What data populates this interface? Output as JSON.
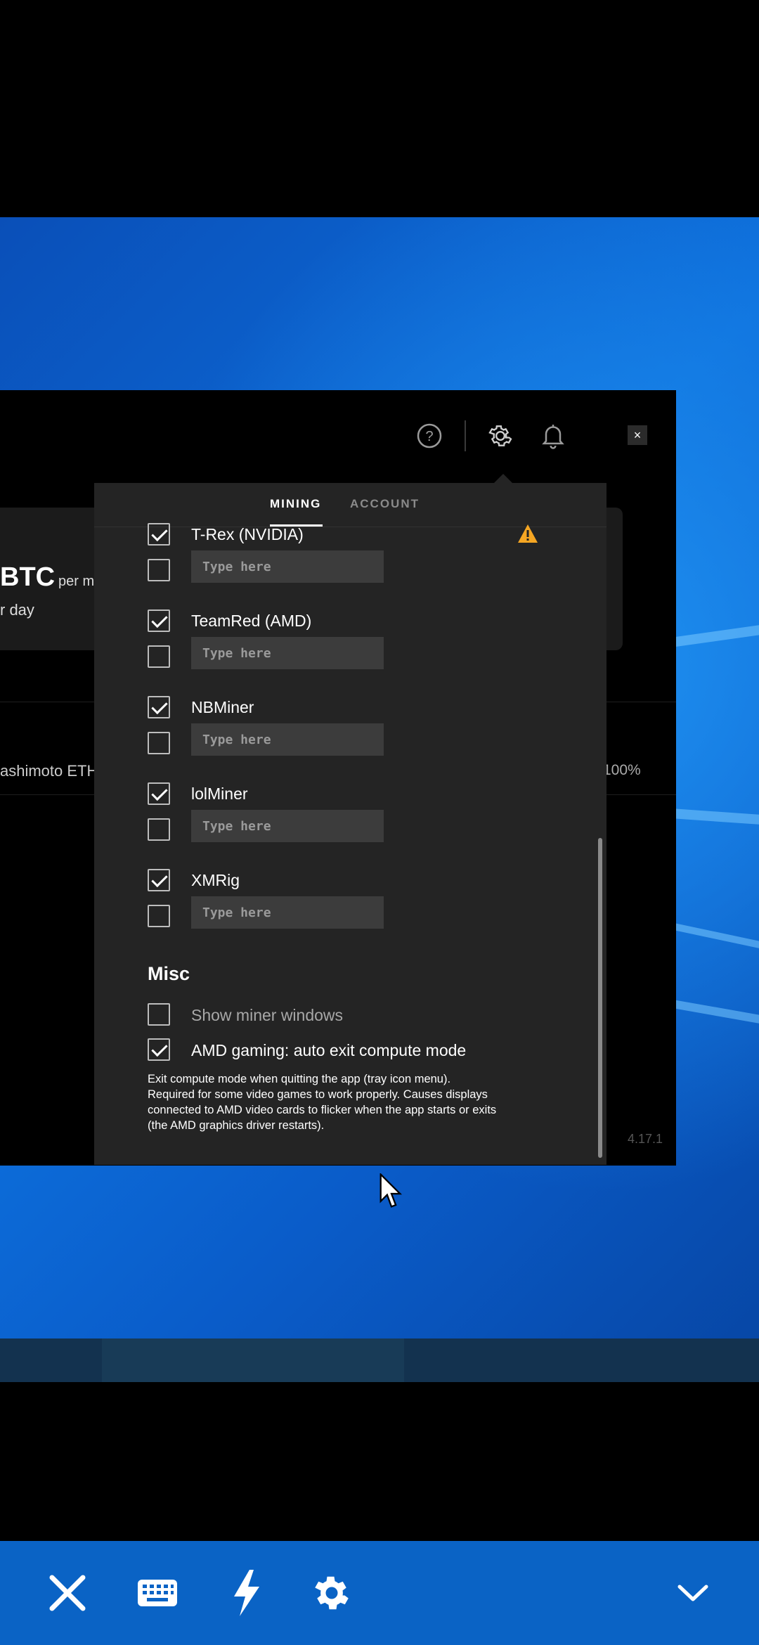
{
  "app": {
    "help_icon": "help-circle-icon",
    "settings_icon": "gear-icon",
    "notifications_icon": "bell-icon",
    "close_label": "×",
    "background": {
      "balance_text": "BTC",
      "per_text": "per m",
      "day_text": "r day",
      "algo_text": "ashimoto ETH",
      "percent_text": "100%",
      "version": "4.17.1"
    }
  },
  "settings": {
    "tabs": [
      {
        "label": "MINING",
        "active": true
      },
      {
        "label": "ACCOUNT",
        "active": false
      }
    ],
    "miners": [
      {
        "name": "T-Rex (NVIDIA)",
        "enabled": true,
        "extra_checked": false,
        "placeholder": "Type here",
        "value": "",
        "warning": true
      },
      {
        "name": "TeamRed (AMD)",
        "enabled": true,
        "extra_checked": false,
        "placeholder": "Type here",
        "value": ""
      },
      {
        "name": "NBMiner",
        "enabled": true,
        "extra_checked": false,
        "placeholder": "Type here",
        "value": ""
      },
      {
        "name": "lolMiner",
        "enabled": true,
        "extra_checked": false,
        "placeholder": "Type here",
        "value": ""
      },
      {
        "name": "XMRig",
        "enabled": true,
        "extra_checked": false,
        "placeholder": "Type here",
        "value": ""
      }
    ],
    "misc": {
      "heading": "Misc",
      "show_miner_windows": {
        "label": "Show miner windows",
        "checked": false
      },
      "amd_gaming": {
        "label": "AMD gaming: auto exit compute mode",
        "checked": true
      },
      "note_lines": [
        "Exit compute mode when quitting the app (tray icon menu).",
        "Required for some video games to work properly. Causes displays",
        "connected to AMD video cards to flicker when the app starts or exits",
        "(the AMD graphics driver restarts)."
      ]
    },
    "warning_icon": "warning-icon",
    "colors": {
      "warning": "#f5a623",
      "panel": "#242424"
    }
  },
  "remote_toolbar": {
    "buttons": [
      {
        "name": "close",
        "icon": "close-icon"
      },
      {
        "name": "keyboard",
        "icon": "keyboard-icon"
      },
      {
        "name": "actions",
        "icon": "lightning-icon"
      },
      {
        "name": "settings",
        "icon": "gear-icon"
      },
      {
        "name": "collapse",
        "icon": "chevron-down-icon"
      }
    ],
    "color": "#0a63c5"
  }
}
